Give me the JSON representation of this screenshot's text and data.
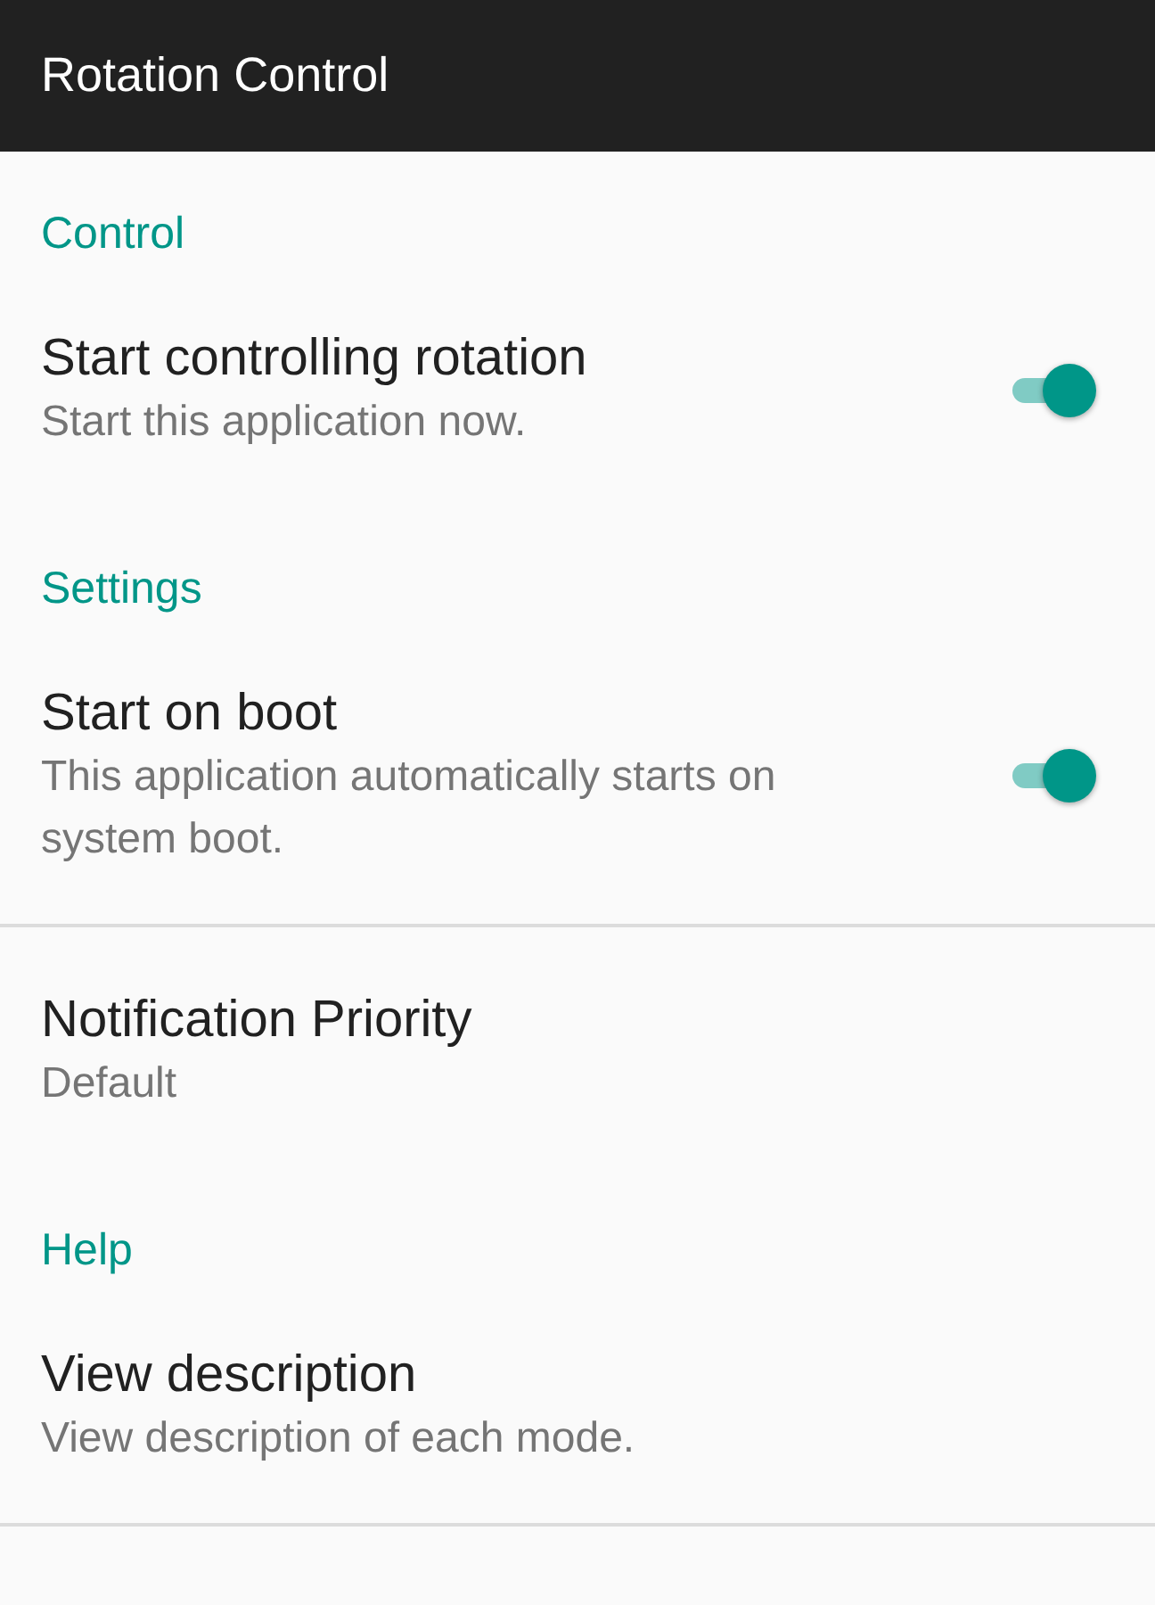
{
  "app_bar": {
    "title": "Rotation Control"
  },
  "sections": [
    {
      "header": "Control",
      "items": [
        {
          "kind": "switch",
          "title": "Start controlling rotation",
          "summary": "Start this application now.",
          "on": true,
          "divider": false
        }
      ]
    },
    {
      "header": "Settings",
      "items": [
        {
          "kind": "switch",
          "title": "Start on boot",
          "summary": "This application automatically starts on system boot.",
          "on": true,
          "divider": true
        },
        {
          "kind": "plain",
          "title": "Notification Priority",
          "summary": "Default",
          "divider": false
        }
      ]
    },
    {
      "header": "Help",
      "items": [
        {
          "kind": "plain",
          "title": "View description",
          "summary": "View description of each mode.",
          "divider": true
        }
      ]
    }
  ]
}
